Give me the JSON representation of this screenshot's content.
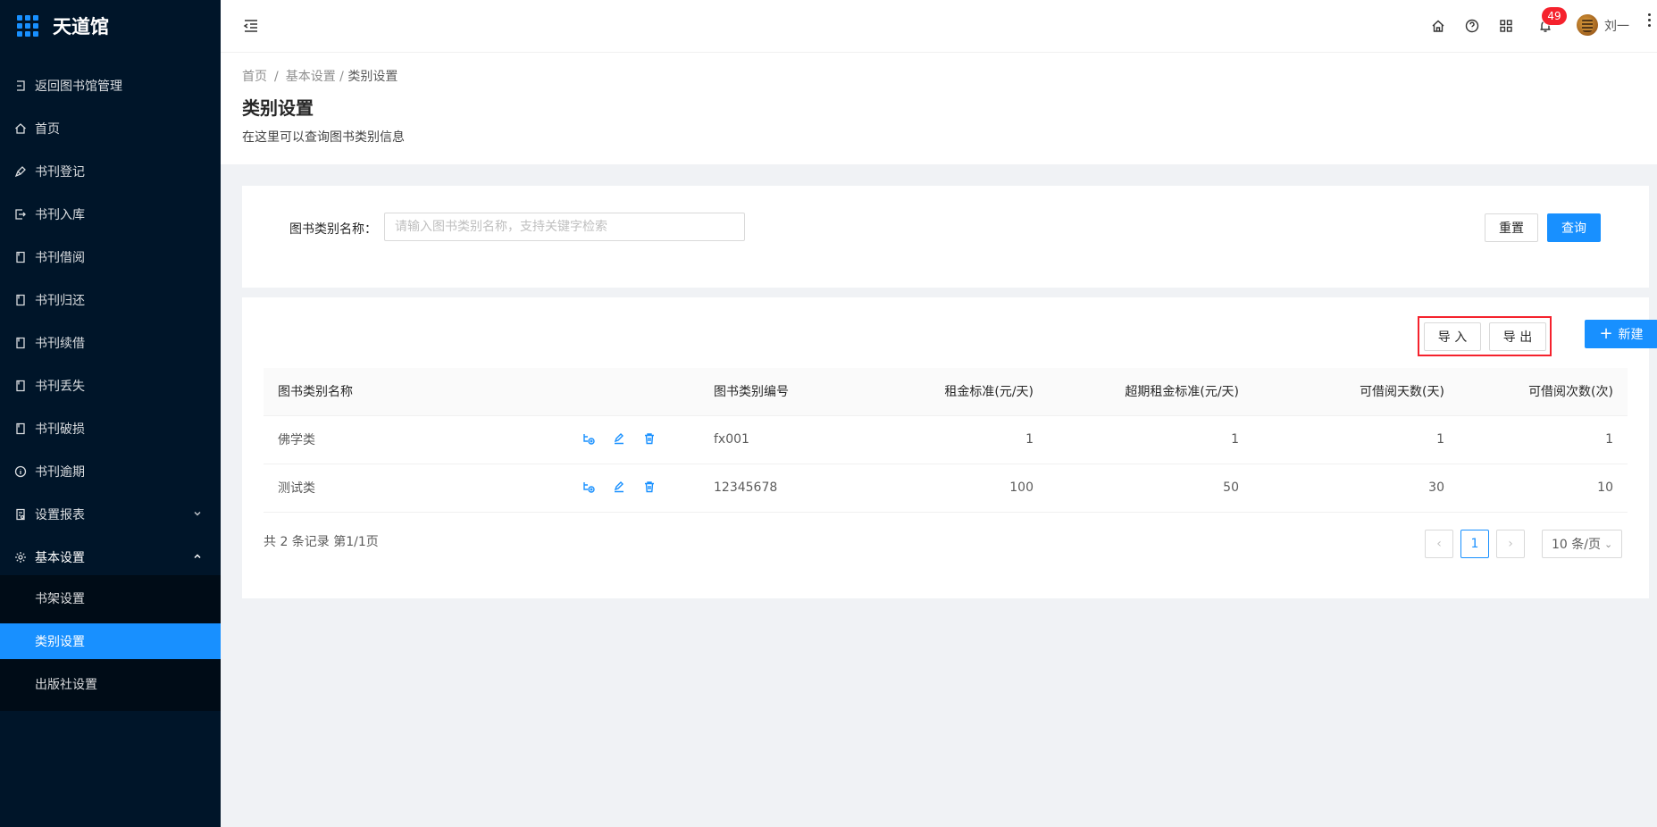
{
  "app": {
    "title": "天道馆"
  },
  "sidebar": {
    "items": [
      {
        "label": "返回图书馆管理",
        "icon": "return-icon"
      },
      {
        "label": "首页",
        "icon": "home-icon"
      },
      {
        "label": "书刊登记",
        "icon": "pen-icon"
      },
      {
        "label": "书刊入库",
        "icon": "login-icon"
      },
      {
        "label": "书刊借阅",
        "icon": "book-icon"
      },
      {
        "label": "书刊归还",
        "icon": "book-icon"
      },
      {
        "label": "书刊续借",
        "icon": "book-icon"
      },
      {
        "label": "书刊丢失",
        "icon": "book-icon"
      },
      {
        "label": "书刊破损",
        "icon": "book-icon"
      },
      {
        "label": "书刊逾期",
        "icon": "info-icon"
      },
      {
        "label": "设置报表",
        "icon": "report-icon"
      },
      {
        "label": "基本设置",
        "icon": "gear-icon"
      }
    ],
    "submenu": [
      {
        "label": "书架设置"
      },
      {
        "label": "类别设置",
        "active": true
      },
      {
        "label": "出版社设置"
      }
    ]
  },
  "header": {
    "notification_count": "49",
    "username": "刘一"
  },
  "breadcrumb": {
    "home": "首页",
    "parent": "基本设置",
    "current": "类别设置"
  },
  "page": {
    "title": "类别设置",
    "description": "在这里可以查询图书类别信息"
  },
  "search": {
    "label": "图书类别名称：",
    "placeholder": "请输入图书类别名称，支持关键字检索",
    "value": "",
    "reset_label": "重置",
    "query_label": "查询"
  },
  "toolbar": {
    "import_label": "导 入",
    "export_label": "导 出",
    "new_label": "新建"
  },
  "table": {
    "columns": [
      "图书类别名称",
      "图书类别编号",
      "租金标准(元/天)",
      "超期租金标准(元/天)",
      "可借阅天数(天)",
      "可借阅次数(次)"
    ],
    "rows": [
      {
        "name": "佛学类",
        "code": "fx001",
        "rent": "1",
        "overdue_rent": "1",
        "days": "1",
        "times": "1"
      },
      {
        "name": "测试类",
        "code": "12345678",
        "rent": "100",
        "overdue_rent": "50",
        "days": "30",
        "times": "10"
      }
    ]
  },
  "pagination": {
    "summary": "共 2 条记录 第1/1页",
    "current_page": "1",
    "page_size": "10 条/页"
  },
  "colors": {
    "primary": "#1890ff",
    "sidebar_bg": "#001529",
    "highlight": "#f5222d"
  }
}
